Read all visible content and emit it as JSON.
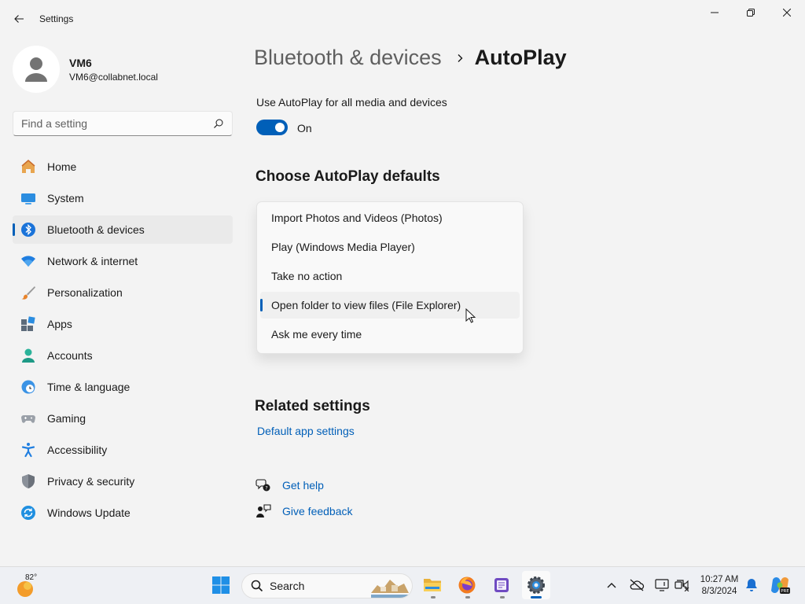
{
  "window": {
    "title": "Settings"
  },
  "profile": {
    "name": "VM6",
    "email": "VM6@collabnet.local"
  },
  "search": {
    "placeholder": "Find a setting"
  },
  "nav": {
    "items": [
      {
        "label": "Home",
        "icon": "home-icon"
      },
      {
        "label": "System",
        "icon": "monitor-icon"
      },
      {
        "label": "Bluetooth & devices",
        "icon": "bluetooth-icon",
        "selected": true
      },
      {
        "label": "Network & internet",
        "icon": "wifi-icon"
      },
      {
        "label": "Personalization",
        "icon": "brush-icon"
      },
      {
        "label": "Apps",
        "icon": "apps-icon"
      },
      {
        "label": "Accounts",
        "icon": "person-icon"
      },
      {
        "label": "Time & language",
        "icon": "globe-clock-icon"
      },
      {
        "label": "Gaming",
        "icon": "controller-icon"
      },
      {
        "label": "Accessibility",
        "icon": "accessibility-icon"
      },
      {
        "label": "Privacy & security",
        "icon": "shield-icon"
      },
      {
        "label": "Windows Update",
        "icon": "update-icon"
      }
    ]
  },
  "breadcrumb": {
    "parent": "Bluetooth & devices",
    "current": "AutoPlay"
  },
  "autoplay": {
    "label": "Use AutoPlay for all media and devices",
    "toggle_state": "On",
    "toggle_on": true
  },
  "defaults": {
    "title": "Choose AutoPlay defaults",
    "options": [
      "Import Photos and Videos (Photos)",
      "Play (Windows Media Player)",
      "Take no action",
      "Open folder to view files (File Explorer)",
      "Ask me every time"
    ],
    "selected_index": 3
  },
  "related": {
    "title": "Related settings",
    "link": "Default app settings"
  },
  "help": {
    "get_help": "Get help",
    "give_feedback": "Give feedback"
  },
  "taskbar": {
    "weather_temp": "82°",
    "search_label": "Search",
    "time": "10:27 AM",
    "date": "8/3/2024"
  },
  "colors": {
    "accent": "#005fb8",
    "background": "#f3f3f3",
    "selected_nav": "#eaeaea"
  }
}
